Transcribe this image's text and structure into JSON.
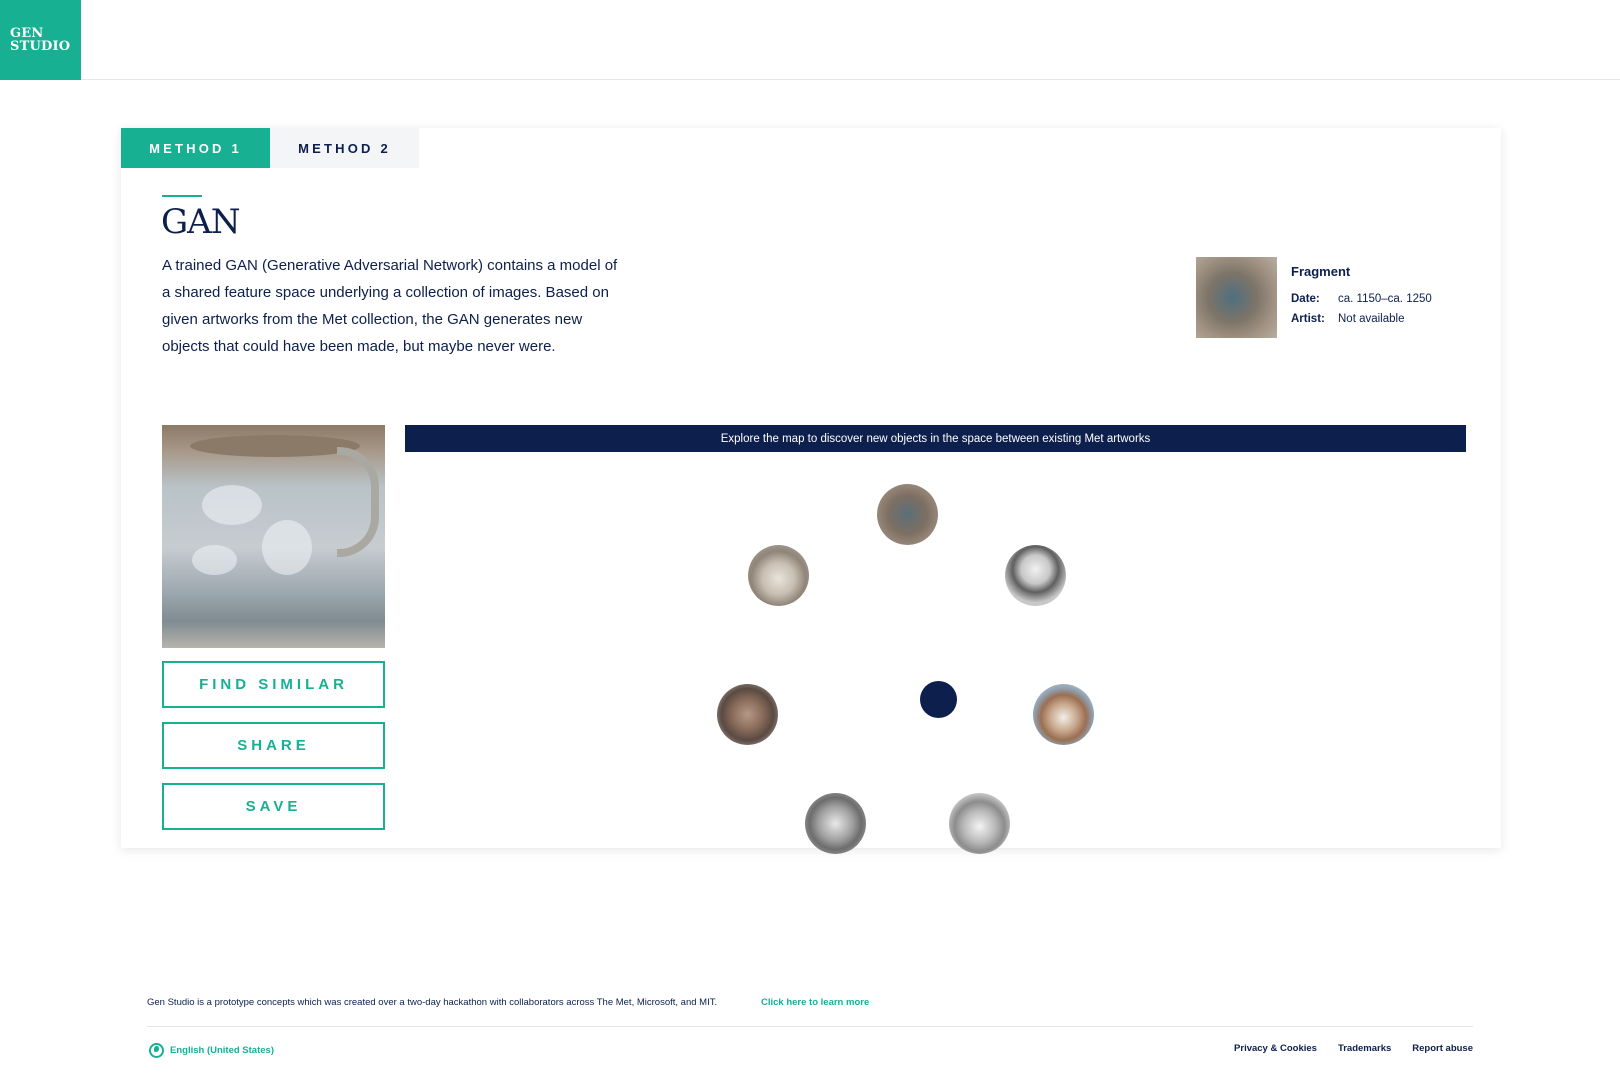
{
  "header": {
    "logo_line1": "GEN",
    "logo_line2": "STUDIO"
  },
  "tabs": [
    {
      "label": "METHOD 1",
      "active": true
    },
    {
      "label": "METHOD 2",
      "active": false
    }
  ],
  "intro": {
    "title": "GAN",
    "description": "A trained GAN (Generative Adversarial Network) contains a model of a shared feature space underlying a collection of images. Based on given artworks from the Met collection, the GAN generates new objects that could have been made, but maybe never were."
  },
  "artwork_info": {
    "name": "Fragment",
    "date_label": "Date:",
    "date_value": "ca. 1150–ca. 1250",
    "artist_label": "Artist:",
    "artist_value": "Not available"
  },
  "actions": {
    "find_similar": "FIND SIMILAR",
    "share": "SHARE",
    "save": "SAVE"
  },
  "map": {
    "banner": "Explore the map to discover new objects in the space between existing Met artworks",
    "items": [
      {
        "icon": "bowl-fragment-thumbnail"
      },
      {
        "icon": "ewer-thumbnail"
      },
      {
        "icon": "goblet-thumbnail"
      },
      {
        "icon": "armor-thumbnail"
      },
      {
        "icon": "porcelain-vase-thumbnail"
      },
      {
        "icon": "glass-vase-thumbnail"
      },
      {
        "icon": "teapot-thumbnail"
      }
    ]
  },
  "footer": {
    "note": "Gen Studio is a prototype concepts which was created over a two-day hackathon with collaborators across The Met, Microsoft, and MIT.",
    "learn_more": "Click here to learn more",
    "language": "English (United States)",
    "links": [
      "Privacy & Cookies",
      "Trademarks",
      "Report abuse"
    ]
  },
  "colors": {
    "accent": "#17b092",
    "navy": "#0c1f4d"
  }
}
